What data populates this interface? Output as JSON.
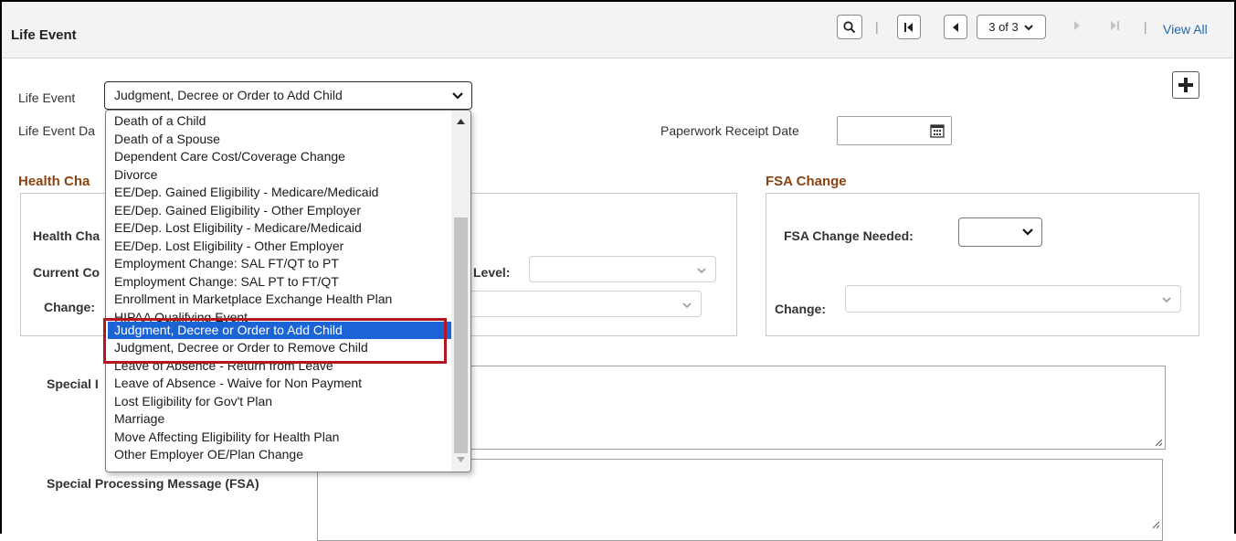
{
  "header": {
    "title": "Life Event",
    "page_indicator": "3 of 3",
    "view_all": "View All",
    "separator": "|"
  },
  "form": {
    "life_event_label": "Life Event",
    "life_event_value": "Judgment, Decree or Order to Add Child",
    "life_event_date_label": "Life Event Da",
    "paperwork_receipt_label": "Paperwork Receipt Date",
    "health_change_title": "Health Cha",
    "health_change_needed_label": "Health Cha",
    "current_coverage_label": "Current Co",
    "change_label": "Change:",
    "level_label": "Level:",
    "special_message_label": "Special I",
    "special_message_fsa_label": "Special Processing Message (FSA)"
  },
  "fsa": {
    "title": "FSA Change",
    "needed_label": "FSA Change Needed:",
    "change_label": "Change:"
  },
  "dropdown": {
    "options": [
      "Death of a Child",
      "Death of a Spouse",
      "Dependent Care Cost/Coverage Change",
      "Divorce",
      "EE/Dep. Gained Eligibility - Medicare/Medicaid",
      "EE/Dep. Gained Eligibility - Other Employer",
      "EE/Dep. Lost Eligibility - Medicare/Medicaid",
      "EE/Dep. Lost Eligibility - Other Employer",
      "Employment Change: SAL FT/QT to PT",
      "Employment Change: SAL PT to FT/QT",
      "Enrollment in Marketplace Exchange Health Plan",
      "HIPAA Qualifying Event",
      "Judgment, Decree or Order to Add Child",
      "Judgment, Decree or Order to Remove Child",
      "Leave of Absence - Return from Leave",
      "Leave of Absence - Waive for Non Payment",
      "Lost Eligibility for Gov't Plan",
      "Marriage",
      "Move Affecting Eligibility for Health Plan",
      "Other Employer OE/Plan Change"
    ],
    "selected_index": 12
  },
  "icons": {
    "search": "search-icon",
    "first": "first-page-icon",
    "prev": "previous-icon",
    "next": "next-icon",
    "last": "last-page-icon",
    "add": "plus-icon",
    "calendar": "calendar-icon"
  },
  "colors": {
    "section_title": "#8a4413",
    "link": "#2267b1",
    "selected_option": "#1b64d6",
    "highlight_border": "#b4161f"
  }
}
